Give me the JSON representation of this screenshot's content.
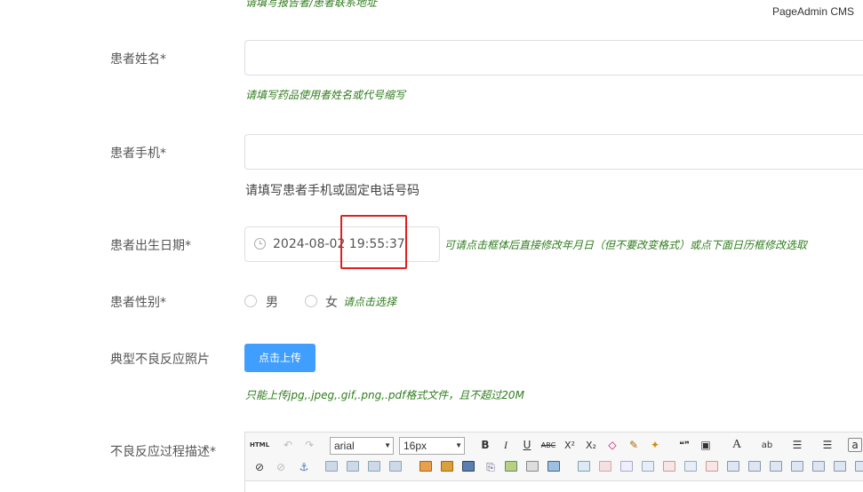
{
  "brand": "PageAdmin CMS",
  "top_hint": "请填写报告者/患者联系地址",
  "fields": {
    "name": {
      "label": "患者姓名*",
      "hint": "请填写药品使用者姓名或代号缩写"
    },
    "phone": {
      "label": "患者手机*",
      "hint": "请填写患者手机或固定电话号码"
    },
    "dob": {
      "label": "患者出生日期*",
      "value": "2024-08-02 19:55:37",
      "hint": "可请点击框体后直接修改年月日（但不要改变格式）或点下面日历框修改选取"
    },
    "gender": {
      "label": "患者性别*",
      "options": [
        "男",
        "女"
      ],
      "hint": "请点击选择"
    },
    "photo": {
      "label": "典型不良反应照片",
      "button": "点击上传",
      "hint": "只能上传jpg,.jpeg,.gif,.png,.pdf格式文件，且不超过20M"
    },
    "desc": {
      "label": "不良反应过程描述*"
    }
  },
  "editor": {
    "font_family": "arial",
    "font_size": "16px",
    "html_label": "HTML",
    "row1_glyphs": [
      "B",
      "I",
      "U",
      "ABC",
      "X²",
      "X₂",
      "◇",
      "✎",
      "✦",
      "❝❞",
      "▣",
      "A",
      "ab",
      "☰",
      "☰",
      "a"
    ],
    "icons": [
      "html-icon",
      "undo-icon",
      "redo-icon",
      "bold-icon",
      "italic-icon",
      "underline-icon",
      "strikethrough-icon",
      "superscript-icon",
      "subscript-icon",
      "eraser-icon",
      "format-painter-icon",
      "auto-format-icon",
      "blockquote-icon",
      "paste-plain-icon",
      "font-color-icon",
      "highlight-icon",
      "ordered-list-icon",
      "unordered-list-icon",
      "link-icon",
      "unlink-icon",
      "anchor-icon",
      "image-icon",
      "video-icon",
      "attachment-icon",
      "table-icon"
    ]
  },
  "colors": {
    "primary": "#409eff",
    "hint_green": "#2f7d1d",
    "highlight_red": "#e02020"
  }
}
